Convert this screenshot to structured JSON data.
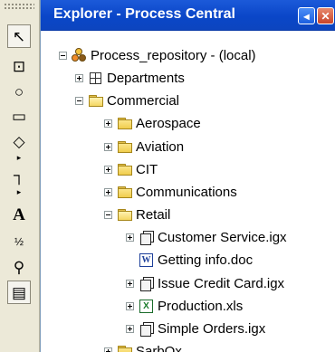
{
  "explorer": {
    "title": "Explorer - Process Central"
  },
  "tools": [
    {
      "name": "pointer-tool",
      "glyph": "↖"
    },
    {
      "name": "activity-tool",
      "glyph": "⊡"
    },
    {
      "name": "ellipse-tool",
      "glyph": "○"
    },
    {
      "name": "rounded-rect-tool",
      "glyph": "▭"
    },
    {
      "name": "decision-tool",
      "glyph": "◇"
    },
    {
      "name": "connector-tool",
      "glyph": "┐"
    },
    {
      "name": "text-tool",
      "glyph": "A"
    },
    {
      "name": "numbering-tool",
      "glyph": "½"
    },
    {
      "name": "zoom-tool",
      "glyph": "⚲"
    },
    {
      "name": "notes-tool",
      "glyph": "▤"
    }
  ],
  "tree": {
    "root": "Process_repository - (local)",
    "departments": "Departments",
    "commercial": "Commercial",
    "aerospace": "Aerospace",
    "aviation": "Aviation",
    "cit": "CIT",
    "communications": "Communications",
    "retail": "Retail",
    "customer_service": "Customer Service.igx",
    "getting_info": "Getting info.doc",
    "issue_credit_card": "Issue Credit Card.igx",
    "production": "Production.xls",
    "simple_orders": "Simple Orders.igx",
    "sarbox": "SarbOx"
  },
  "colors": {
    "titlebar": "#0a46c8",
    "folder": "#f0cd4d"
  }
}
